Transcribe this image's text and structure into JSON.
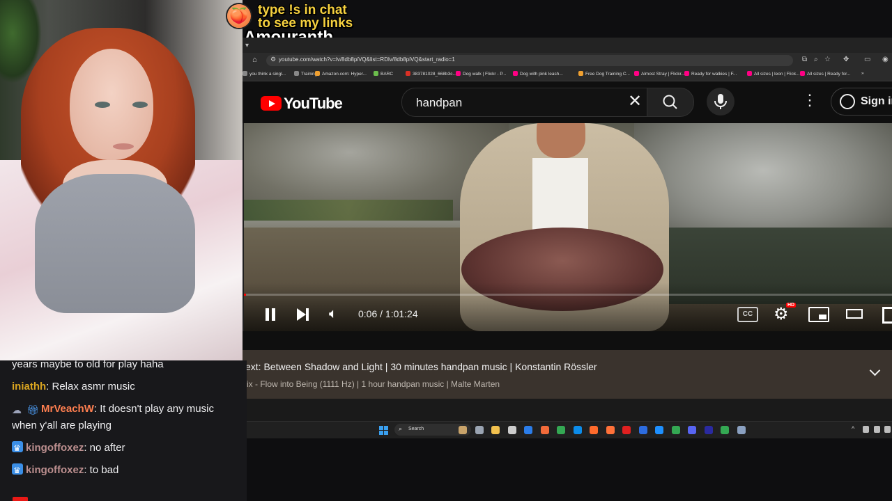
{
  "overlay": {
    "line1": "type !s in chat",
    "line2": "to see my links",
    "streamer": "Amouranth",
    "peach_icon": "🍑"
  },
  "browser": {
    "url": "youtube.com/watch?v=lv/8db8piVQ&list=RDlv/8db8piVQ&start_radio=1",
    "bookmarks": [
      {
        "label": "you think a singl...",
        "color": "#888888"
      },
      {
        "label": "Training",
        "color": "#888888"
      },
      {
        "label": "Amazon.com: Hyper...",
        "color": "#f0a030"
      },
      {
        "label": "BARC",
        "color": "#6bbd4c"
      },
      {
        "label": "383781028_668b3c...",
        "color": "#d93025"
      },
      {
        "label": "Dog walk | Flickr - P...",
        "color": "#ff0084"
      },
      {
        "label": "Dog with pink leash...",
        "color": "#ff0084"
      },
      {
        "label": "Free Dog Training C...",
        "color": "#f0a030"
      },
      {
        "label": "Almost Stray | Flickr...",
        "color": "#ff0084"
      },
      {
        "label": "Ready for walkies | F...",
        "color": "#ff0084"
      },
      {
        "label": "All sizes | leon | Flick...",
        "color": "#ff0084"
      },
      {
        "label": "All sizes | Ready for...",
        "color": "#ff0084"
      }
    ]
  },
  "youtube": {
    "logo_text": "YouTube",
    "search_value": "handpan",
    "signin_label": "Sign in",
    "player": {
      "time": "0:06 / 1:01:24",
      "progress_fraction": 0.0016,
      "cc_label": "CC",
      "hd_label": "HD"
    },
    "queue": {
      "next_title": "ext: Between Shadow and Light | 30 minutes handpan music | Konstantin Rössler",
      "next_sub": "ix - Flow into Being (1111 Hz) | 1 hour handpan music | Malte Marten"
    }
  },
  "taskbar": {
    "search_label": "Search",
    "icons": [
      "#c8a36a",
      "#9aa4b2",
      "#f2c14e",
      "#cccccc",
      "#2b7de9",
      "#f26b3a",
      "#34a853",
      "#0c8ce9",
      "#ff6b2c",
      "#ff7139",
      "#e02020",
      "#2d6cdf",
      "#1e90ff",
      "#34a853",
      "#5865f2",
      "#2a2aa0",
      "#34a853",
      "#8aa0c0"
    ]
  },
  "chat": {
    "messages": [
      {
        "user": "",
        "user_color": "#efeff1",
        "text": "years maybe to old for play haha",
        "badges": []
      },
      {
        "user": "iniathh",
        "user_color": "#daa520",
        "text": ": Relax asmr music",
        "badges": []
      },
      {
        "user": "MrVeachW",
        "user_color": "#ff7f50",
        "text": ": It doesn't play any music",
        "badges": [
          "ghost",
          "gift"
        ]
      },
      {
        "user": "",
        "user_color": "#efeff1",
        "text": "when y'all are playing",
        "badges": []
      },
      {
        "user": "kingoffoxez",
        "user_color": "#bc8f8f",
        "text": ": no after",
        "badges": [
          "crown"
        ]
      },
      {
        "user": "kingoffoxez",
        "user_color": "#bc8f8f",
        "text": ": to bad",
        "badges": [
          "crown"
        ]
      }
    ]
  }
}
